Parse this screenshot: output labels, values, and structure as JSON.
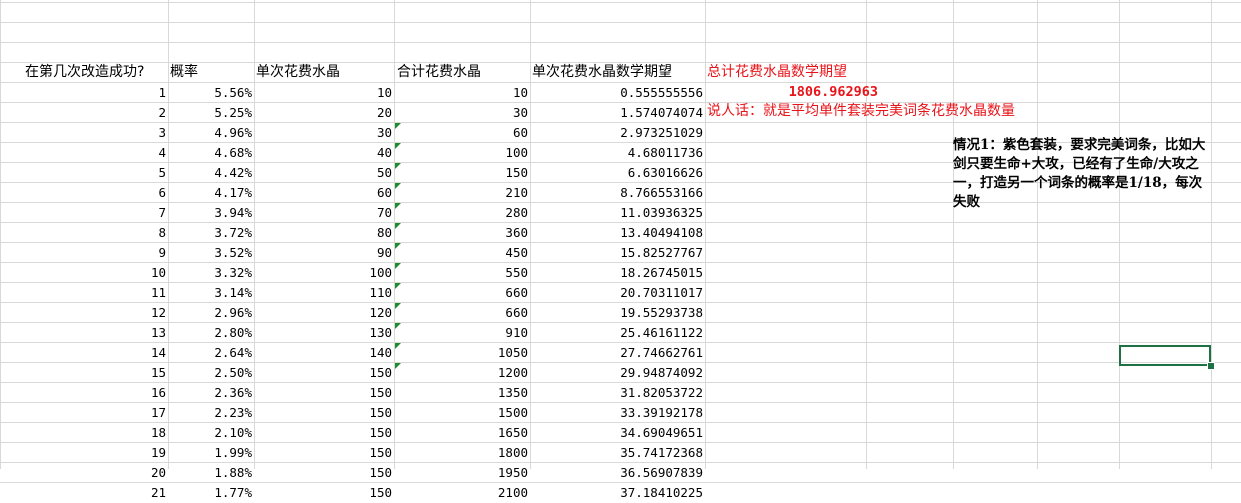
{
  "headers": {
    "attempt": "在第几次改造成功?",
    "prob": "概率",
    "single_cost": "单次花费水晶",
    "total_cost": "合计花费水晶",
    "single_expect": "单次花费水晶数学期望",
    "total_expect": "总计花费水晶数学期望"
  },
  "total_expect_value": "1806.962963",
  "plain_words": "说人话：就是平均单件套装完美词条花费水晶数量",
  "note_text": "情况1：紫色套装，要求完美词条，比如大剑只要生命+大攻，已经有了生命/大攻之一，打造另一个词条的概率是1/18，每次失败",
  "rows": [
    {
      "n": "1",
      "p": "5.56%",
      "c": "10",
      "t": "10",
      "e": "0.555555556"
    },
    {
      "n": "2",
      "p": "5.25%",
      "c": "20",
      "t": "30",
      "e": "1.574074074"
    },
    {
      "n": "3",
      "p": "4.96%",
      "c": "30",
      "t": "60",
      "e": "2.973251029"
    },
    {
      "n": "4",
      "p": "4.68%",
      "c": "40",
      "t": "100",
      "e": "4.68011736"
    },
    {
      "n": "5",
      "p": "4.42%",
      "c": "50",
      "t": "150",
      "e": "6.63016626"
    },
    {
      "n": "6",
      "p": "4.17%",
      "c": "60",
      "t": "210",
      "e": "8.766553166"
    },
    {
      "n": "7",
      "p": "3.94%",
      "c": "70",
      "t": "280",
      "e": "11.03936325"
    },
    {
      "n": "8",
      "p": "3.72%",
      "c": "80",
      "t": "360",
      "e": "13.40494108"
    },
    {
      "n": "9",
      "p": "3.52%",
      "c": "90",
      "t": "450",
      "e": "15.82527767"
    },
    {
      "n": "10",
      "p": "3.32%",
      "c": "100",
      "t": "550",
      "e": "18.26745015"
    },
    {
      "n": "11",
      "p": "3.14%",
      "c": "110",
      "t": "660",
      "e": "20.70311017"
    },
    {
      "n": "12",
      "p": "2.96%",
      "c": "120",
      "t": "660",
      "e": "19.55293738"
    },
    {
      "n": "13",
      "p": "2.80%",
      "c": "130",
      "t": "910",
      "e": "25.46161122"
    },
    {
      "n": "14",
      "p": "2.64%",
      "c": "140",
      "t": "1050",
      "e": "27.74662761"
    },
    {
      "n": "15",
      "p": "2.50%",
      "c": "150",
      "t": "1200",
      "e": "29.94874092"
    },
    {
      "n": "16",
      "p": "2.36%",
      "c": "150",
      "t": "1350",
      "e": "31.82053722"
    },
    {
      "n": "17",
      "p": "2.23%",
      "c": "150",
      "t": "1500",
      "e": "33.39192178"
    },
    {
      "n": "18",
      "p": "2.10%",
      "c": "150",
      "t": "1650",
      "e": "34.69049651"
    },
    {
      "n": "19",
      "p": "1.99%",
      "c": "150",
      "t": "1800",
      "e": "35.74172368"
    },
    {
      "n": "20",
      "p": "1.88%",
      "c": "150",
      "t": "1950",
      "e": "36.56907839"
    },
    {
      "n": "21",
      "p": "1.77%",
      "c": "150",
      "t": "2100",
      "e": "37.18410225"
    }
  ],
  "error_flag_rows": [
    3,
    4,
    5,
    6,
    7,
    8,
    9,
    10,
    11,
    12,
    13,
    14,
    15
  ],
  "colors": {
    "accent_red": "#e8141a",
    "grid": "#d9d9d9",
    "selection": "#1e7145",
    "error_flag": "#1e8c2e"
  }
}
